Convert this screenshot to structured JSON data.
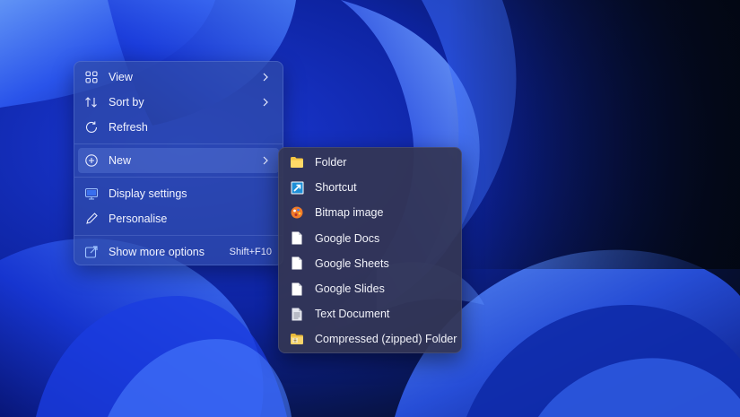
{
  "context_menu": {
    "items": [
      {
        "label": "View",
        "icon": "grid-icon",
        "has_submenu": true
      },
      {
        "label": "Sort by",
        "icon": "sort-icon",
        "has_submenu": true
      },
      {
        "label": "Refresh",
        "icon": "refresh-icon",
        "has_submenu": false
      }
    ],
    "new_item": {
      "label": "New",
      "icon": "plus-circle-icon",
      "has_submenu": true
    },
    "display_items": [
      {
        "label": "Display settings",
        "icon": "display-icon"
      },
      {
        "label": "Personalise",
        "icon": "pen-icon"
      }
    ],
    "more_options": {
      "label": "Show more options",
      "icon": "share-icon",
      "shortcut": "Shift+F10"
    }
  },
  "new_submenu": {
    "items": [
      {
        "label": "Folder",
        "icon": "folder-icon"
      },
      {
        "label": "Shortcut",
        "icon": "shortcut-icon"
      },
      {
        "label": "Bitmap image",
        "icon": "paint-icon"
      },
      {
        "label": "Google Docs",
        "icon": "document-icon"
      },
      {
        "label": "Google Sheets",
        "icon": "document-icon"
      },
      {
        "label": "Google Slides",
        "icon": "document-icon"
      },
      {
        "label": "Text Document",
        "icon": "text-document-icon"
      },
      {
        "label": "Compressed (zipped) Folder",
        "icon": "zip-folder-icon"
      }
    ]
  },
  "colors": {
    "menu_bg": "#304ca8",
    "submenu_bg": "#343654",
    "folder_yellow": "#f4c542",
    "shortcut_blue": "#1e8fd8",
    "wallpaper_accent": "#1f4ff0"
  }
}
